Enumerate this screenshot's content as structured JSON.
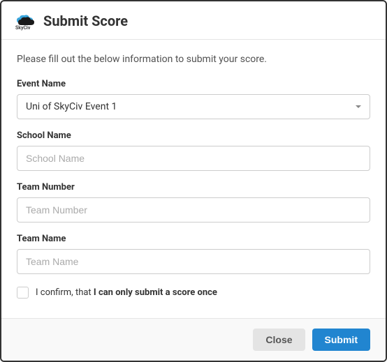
{
  "header": {
    "logo_text": "SkyCiv",
    "title": "Submit Score"
  },
  "body": {
    "description": "Please fill out the below information to submit your score.",
    "fields": {
      "event_name": {
        "label": "Event Name",
        "value": "Uni of SkyCiv Event 1"
      },
      "school_name": {
        "label": "School Name",
        "placeholder": "School Name"
      },
      "team_number": {
        "label": "Team Number",
        "placeholder": "Team Number"
      },
      "team_name": {
        "label": "Team Name",
        "placeholder": "Team Name"
      }
    },
    "confirm": {
      "prefix": "I confirm, that ",
      "bold": "I can only submit a score once"
    }
  },
  "footer": {
    "close_label": "Close",
    "submit_label": "Submit"
  }
}
